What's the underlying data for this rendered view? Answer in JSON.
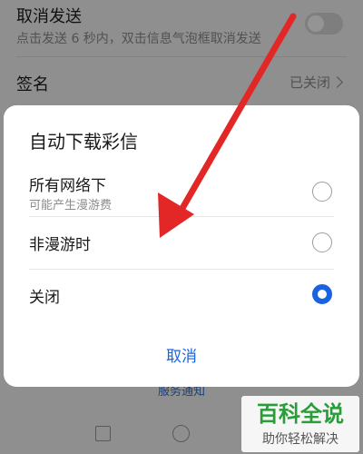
{
  "settings": {
    "cancel_send": {
      "title": "取消发送",
      "subtitle": "点击发送 6 秒内，双击信息气泡框取消发送",
      "toggle_on": false
    },
    "signature": {
      "title": "签名",
      "value": "已关闭"
    },
    "service_notice": "服务通知"
  },
  "dialog": {
    "title": "自动下载彩信",
    "options": [
      {
        "label": "所有网络下",
        "subtitle": "可能产生漫游费",
        "selected": false
      },
      {
        "label": "非漫游时",
        "selected": false
      },
      {
        "label": "关闭",
        "selected": true
      }
    ],
    "cancel_label": "取消"
  },
  "watermark": {
    "title": "百科全说",
    "subtitle": "助你轻松解决"
  },
  "colors": {
    "accent": "#1a63e0",
    "annotation": "#e32626",
    "watermark_green": "#2a9d3a"
  },
  "icons": {
    "chevron": "chevron-right-icon",
    "nav_recent": "square-icon",
    "nav_home": "circle-icon"
  }
}
